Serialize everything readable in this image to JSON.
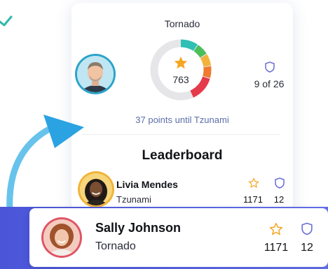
{
  "card": {
    "title": "Tornado",
    "gauge_value": "763",
    "rank_text": "9 of 26",
    "points_until": "37 points until Tzunami"
  },
  "leaderboard": {
    "title": "Leaderboard",
    "entries": [
      {
        "name": "Livia Mendes",
        "level": "Tzunami",
        "score": "1171",
        "rank": "12"
      }
    ]
  },
  "highlight": {
    "name": "Sally Johnson",
    "level": "Tornado",
    "score": "1171",
    "rank": "12"
  },
  "icons": {
    "star": "star-icon",
    "shield": "shield-icon",
    "arrow": "curved-arrow-icon"
  },
  "colors": {
    "accent_blue": "#2ba3c8",
    "star_gold": "#f5a623",
    "shield_purple": "#6b6fd6",
    "band_purple": "#4a55d8",
    "text_link": "#5b6ea8"
  }
}
